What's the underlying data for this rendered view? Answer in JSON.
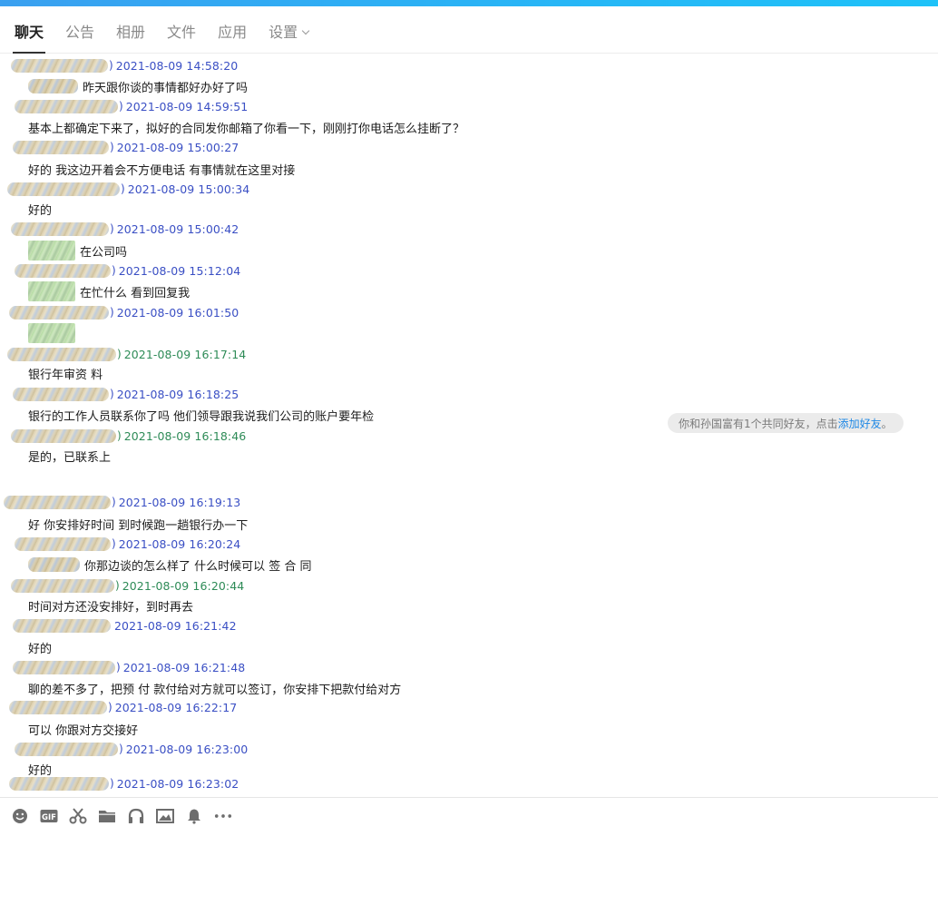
{
  "tabs": [
    {
      "label": "聊天",
      "active": true
    },
    {
      "label": "公告",
      "active": false
    },
    {
      "label": "相册",
      "active": false
    },
    {
      "label": "文件",
      "active": false
    },
    {
      "label": "应用",
      "active": false
    },
    {
      "label": "设置",
      "active": false,
      "dropdown": true
    }
  ],
  "messages": [
    {
      "sender_end": ")",
      "time": "2021-08-09 14:58:20",
      "color": "blue",
      "text": "昨天跟你谈的事情都好办好了吗",
      "body_blur": true
    },
    {
      "sender_end": ")",
      "time": "2021-08-09 14:59:51",
      "color": "blue",
      "text": "基本上都确定下来了，拟好的合同发你邮箱了你看一下，刚刚打你电话怎么挂断了？"
    },
    {
      "sender_end": ")",
      "time": "2021-08-09 15:00:27",
      "color": "blue",
      "text": "好的 我这边开着会不方便电话 有事情就在这里对接"
    },
    {
      "sender_end": ")",
      "time": "2021-08-09 15:00:34",
      "color": "blue",
      "text": "好的"
    },
    {
      "sender_end": ")",
      "time": "2021-08-09 15:00:42",
      "color": "blue",
      "text": "在公司吗",
      "body_blur": true,
      "body_blur_green": true
    },
    {
      "sender_end": ")",
      "time": "2021-08-09 15:12:04",
      "color": "blue",
      "text": "在忙什么  看到回复我",
      "body_blur": true,
      "body_blur_green": true
    },
    {
      "sender_end": ")",
      "time": "2021-08-09 16:01:50",
      "color": "blue",
      "text": "",
      "body_blur": true,
      "body_blur_green": true
    },
    {
      "sender_end": ")",
      "time": "2021-08-09 16:17:14",
      "color": "green",
      "text": "银行年审资 料"
    },
    {
      "sender_end": ")",
      "time": "2021-08-09 16:18:25",
      "color": "blue",
      "text": "银行的工作人员联系你了吗  他们领导跟我说我们公司的账户要年检"
    },
    {
      "sender_end": ")",
      "time": "2021-08-09 16:18:46",
      "color": "green",
      "text": "是的，已联系上"
    },
    {
      "sender_end": ")",
      "time": "2021-08-09 16:19:13",
      "color": "blue",
      "text": "好  你安排好时间 到时候跑一趟银行办一下"
    },
    {
      "sender_end": ")",
      "time": "2021-08-09 16:20:24",
      "color": "blue",
      "text": "你那边谈的怎么样了  什么时候可以 签 合 同",
      "body_blur": true
    },
    {
      "sender_end": ")",
      "time": "2021-08-09 16:20:44",
      "color": "green",
      "text": "时间对方还没安排好，到时再去"
    },
    {
      "sender_end": "",
      "time": "2021-08-09 16:21:42",
      "color": "blue",
      "text": "好的"
    },
    {
      "sender_end": ")",
      "time": "2021-08-09 16:21:48",
      "color": "blue",
      "text": "聊的差不多了，把预 付 款付给对方就可以签订，你安排下把款付给对方"
    },
    {
      "sender_end": ")",
      "time": "2021-08-09 16:22:17",
      "color": "blue",
      "text": "可以  你跟对方交接好"
    },
    {
      "sender_end": ")",
      "time": "2021-08-09 16:23:00",
      "color": "blue",
      "text": "好的"
    },
    {
      "sender_end": ")",
      "time": "2021-08-09 16:23:02",
      "color": "blue",
      "text": ""
    }
  ],
  "notice": {
    "text": "你和孙国富有1个共同好友，点击",
    "link": "添加好友",
    "suffix": "。"
  },
  "toolbar": [
    {
      "icon": "emoji-icon"
    },
    {
      "icon": "gif-icon",
      "label": "GIF"
    },
    {
      "icon": "scissors-icon"
    },
    {
      "icon": "folder-icon"
    },
    {
      "icon": "music-icon"
    },
    {
      "icon": "image-icon"
    },
    {
      "icon": "bell-icon"
    },
    {
      "icon": "more-icon"
    }
  ],
  "colors": {
    "timestamp_blue": "#3a4fc4",
    "timestamp_green": "#2e8b57",
    "link": "#1e88e5",
    "accent_bar": "#27b6f6"
  }
}
